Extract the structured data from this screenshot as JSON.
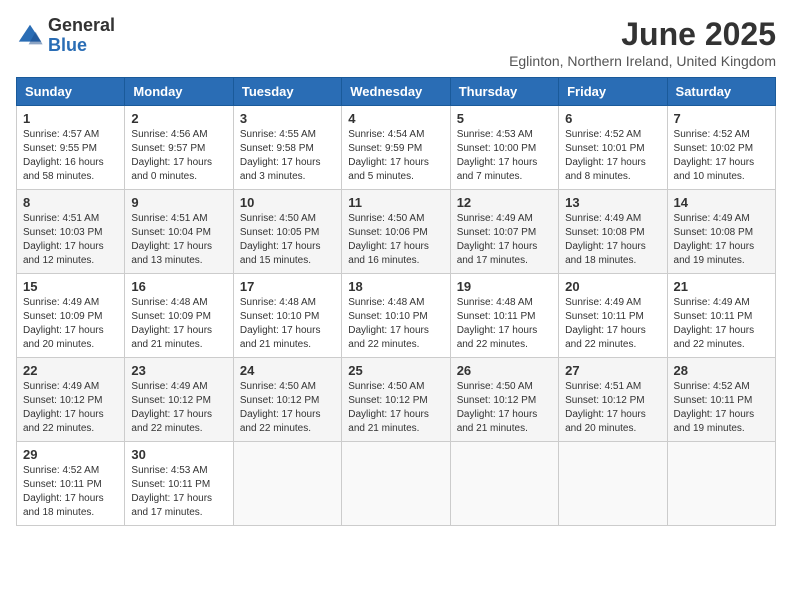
{
  "logo": {
    "text_general": "General",
    "text_blue": "Blue"
  },
  "title": "June 2025",
  "location": "Eglinton, Northern Ireland, United Kingdom",
  "weekdays": [
    "Sunday",
    "Monday",
    "Tuesday",
    "Wednesday",
    "Thursday",
    "Friday",
    "Saturday"
  ],
  "weeks": [
    [
      {
        "day": "1",
        "sunrise": "Sunrise: 4:57 AM",
        "sunset": "Sunset: 9:55 PM",
        "daylight": "Daylight: 16 hours and 58 minutes."
      },
      {
        "day": "2",
        "sunrise": "Sunrise: 4:56 AM",
        "sunset": "Sunset: 9:57 PM",
        "daylight": "Daylight: 17 hours and 0 minutes."
      },
      {
        "day": "3",
        "sunrise": "Sunrise: 4:55 AM",
        "sunset": "Sunset: 9:58 PM",
        "daylight": "Daylight: 17 hours and 3 minutes."
      },
      {
        "day": "4",
        "sunrise": "Sunrise: 4:54 AM",
        "sunset": "Sunset: 9:59 PM",
        "daylight": "Daylight: 17 hours and 5 minutes."
      },
      {
        "day": "5",
        "sunrise": "Sunrise: 4:53 AM",
        "sunset": "Sunset: 10:00 PM",
        "daylight": "Daylight: 17 hours and 7 minutes."
      },
      {
        "day": "6",
        "sunrise": "Sunrise: 4:52 AM",
        "sunset": "Sunset: 10:01 PM",
        "daylight": "Daylight: 17 hours and 8 minutes."
      },
      {
        "day": "7",
        "sunrise": "Sunrise: 4:52 AM",
        "sunset": "Sunset: 10:02 PM",
        "daylight": "Daylight: 17 hours and 10 minutes."
      }
    ],
    [
      {
        "day": "8",
        "sunrise": "Sunrise: 4:51 AM",
        "sunset": "Sunset: 10:03 PM",
        "daylight": "Daylight: 17 hours and 12 minutes."
      },
      {
        "day": "9",
        "sunrise": "Sunrise: 4:51 AM",
        "sunset": "Sunset: 10:04 PM",
        "daylight": "Daylight: 17 hours and 13 minutes."
      },
      {
        "day": "10",
        "sunrise": "Sunrise: 4:50 AM",
        "sunset": "Sunset: 10:05 PM",
        "daylight": "Daylight: 17 hours and 15 minutes."
      },
      {
        "day": "11",
        "sunrise": "Sunrise: 4:50 AM",
        "sunset": "Sunset: 10:06 PM",
        "daylight": "Daylight: 17 hours and 16 minutes."
      },
      {
        "day": "12",
        "sunrise": "Sunrise: 4:49 AM",
        "sunset": "Sunset: 10:07 PM",
        "daylight": "Daylight: 17 hours and 17 minutes."
      },
      {
        "day": "13",
        "sunrise": "Sunrise: 4:49 AM",
        "sunset": "Sunset: 10:08 PM",
        "daylight": "Daylight: 17 hours and 18 minutes."
      },
      {
        "day": "14",
        "sunrise": "Sunrise: 4:49 AM",
        "sunset": "Sunset: 10:08 PM",
        "daylight": "Daylight: 17 hours and 19 minutes."
      }
    ],
    [
      {
        "day": "15",
        "sunrise": "Sunrise: 4:49 AM",
        "sunset": "Sunset: 10:09 PM",
        "daylight": "Daylight: 17 hours and 20 minutes."
      },
      {
        "day": "16",
        "sunrise": "Sunrise: 4:48 AM",
        "sunset": "Sunset: 10:09 PM",
        "daylight": "Daylight: 17 hours and 21 minutes."
      },
      {
        "day": "17",
        "sunrise": "Sunrise: 4:48 AM",
        "sunset": "Sunset: 10:10 PM",
        "daylight": "Daylight: 17 hours and 21 minutes."
      },
      {
        "day": "18",
        "sunrise": "Sunrise: 4:48 AM",
        "sunset": "Sunset: 10:10 PM",
        "daylight": "Daylight: 17 hours and 22 minutes."
      },
      {
        "day": "19",
        "sunrise": "Sunrise: 4:48 AM",
        "sunset": "Sunset: 10:11 PM",
        "daylight": "Daylight: 17 hours and 22 minutes."
      },
      {
        "day": "20",
        "sunrise": "Sunrise: 4:49 AM",
        "sunset": "Sunset: 10:11 PM",
        "daylight": "Daylight: 17 hours and 22 minutes."
      },
      {
        "day": "21",
        "sunrise": "Sunrise: 4:49 AM",
        "sunset": "Sunset: 10:11 PM",
        "daylight": "Daylight: 17 hours and 22 minutes."
      }
    ],
    [
      {
        "day": "22",
        "sunrise": "Sunrise: 4:49 AM",
        "sunset": "Sunset: 10:12 PM",
        "daylight": "Daylight: 17 hours and 22 minutes."
      },
      {
        "day": "23",
        "sunrise": "Sunrise: 4:49 AM",
        "sunset": "Sunset: 10:12 PM",
        "daylight": "Daylight: 17 hours and 22 minutes."
      },
      {
        "day": "24",
        "sunrise": "Sunrise: 4:50 AM",
        "sunset": "Sunset: 10:12 PM",
        "daylight": "Daylight: 17 hours and 22 minutes."
      },
      {
        "day": "25",
        "sunrise": "Sunrise: 4:50 AM",
        "sunset": "Sunset: 10:12 PM",
        "daylight": "Daylight: 17 hours and 21 minutes."
      },
      {
        "day": "26",
        "sunrise": "Sunrise: 4:50 AM",
        "sunset": "Sunset: 10:12 PM",
        "daylight": "Daylight: 17 hours and 21 minutes."
      },
      {
        "day": "27",
        "sunrise": "Sunrise: 4:51 AM",
        "sunset": "Sunset: 10:12 PM",
        "daylight": "Daylight: 17 hours and 20 minutes."
      },
      {
        "day": "28",
        "sunrise": "Sunrise: 4:52 AM",
        "sunset": "Sunset: 10:11 PM",
        "daylight": "Daylight: 17 hours and 19 minutes."
      }
    ],
    [
      {
        "day": "29",
        "sunrise": "Sunrise: 4:52 AM",
        "sunset": "Sunset: 10:11 PM",
        "daylight": "Daylight: 17 hours and 18 minutes."
      },
      {
        "day": "30",
        "sunrise": "Sunrise: 4:53 AM",
        "sunset": "Sunset: 10:11 PM",
        "daylight": "Daylight: 17 hours and 17 minutes."
      },
      null,
      null,
      null,
      null,
      null
    ]
  ],
  "accent_color": "#2a6db5"
}
